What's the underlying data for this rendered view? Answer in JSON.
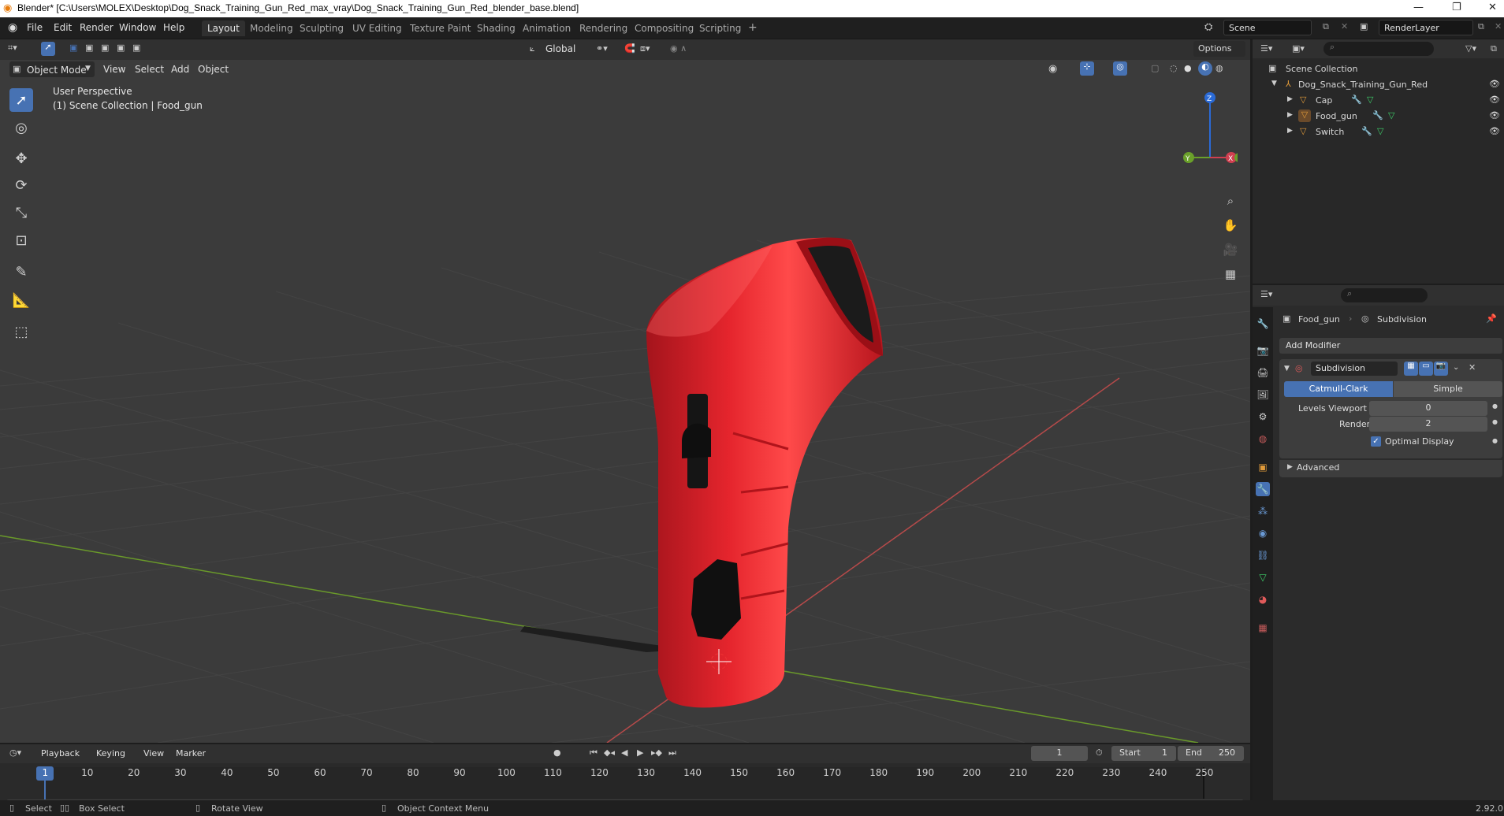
{
  "window": {
    "title": "Blender* [C:\\Users\\MOLEX\\Desktop\\Dog_Snack_Training_Gun_Red_max_vray\\Dog_Snack_Training_Gun_Red_blender_base.blend]",
    "controls": [
      "—",
      "❐",
      "✕"
    ]
  },
  "menubar": {
    "items": [
      "File",
      "Edit",
      "Render",
      "Window",
      "Help"
    ],
    "workspaces": [
      "Layout",
      "Modeling",
      "Sculpting",
      "UV Editing",
      "Texture Paint",
      "Shading",
      "Animation",
      "Rendering",
      "Compositing",
      "Scripting"
    ],
    "active_workspace": "Layout",
    "add_label": "+",
    "scene": "Scene",
    "view_layer": "RenderLayer"
  },
  "toolheader": {
    "transform_orientation": "Global",
    "options_label": "Options"
  },
  "viewport": {
    "mode": "Object Mode",
    "menus": [
      "View",
      "Select",
      "Add",
      "Object"
    ],
    "overlay_line1": "User Perspective",
    "overlay_line2": "(1) Scene Collection | Food_gun",
    "gizmo_axes": {
      "z": "Z",
      "y": "Y",
      "x": "X"
    },
    "colors": {
      "background": "#3b3b3b",
      "object": "#e4222c",
      "x_axis": "#b64a4a",
      "y_axis": "#6a9a2a",
      "select": "#4772b3"
    }
  },
  "outliner": {
    "root": "Scene Collection",
    "collection": "Dog_Snack_Training_Gun_Red",
    "objects": [
      "Cap",
      "Food_gun",
      "Switch"
    ]
  },
  "properties": {
    "object_name": "Food_gun",
    "modifier_path": "Subdivision",
    "add_modifier": "Add Modifier",
    "modifier": {
      "name": "Subdivision",
      "types": [
        "Catmull-Clark",
        "Simple"
      ],
      "active_type": "Catmull-Clark",
      "levels_viewport_label": "Levels Viewport",
      "levels_viewport": "0",
      "render_label": "Render",
      "render": "2",
      "optimal_display_label": "Optimal Display",
      "optimal_display": true,
      "advanced_label": "Advanced"
    }
  },
  "timeline": {
    "menus": [
      "Playback",
      "Keying",
      "View",
      "Marker"
    ],
    "current_frame": "1",
    "start_label": "Start",
    "start": "1",
    "end_label": "End",
    "end": "250",
    "ticks": [
      "1",
      "10",
      "20",
      "30",
      "40",
      "50",
      "60",
      "70",
      "80",
      "90",
      "100",
      "110",
      "120",
      "130",
      "140",
      "150",
      "160",
      "170",
      "180",
      "190",
      "200",
      "210",
      "220",
      "230",
      "240",
      "250"
    ]
  },
  "statusbar": {
    "select": "Select",
    "box_select": "Box Select",
    "rotate_view": "Rotate View",
    "context_menu": "Object Context Menu",
    "version": "2.92.0"
  }
}
